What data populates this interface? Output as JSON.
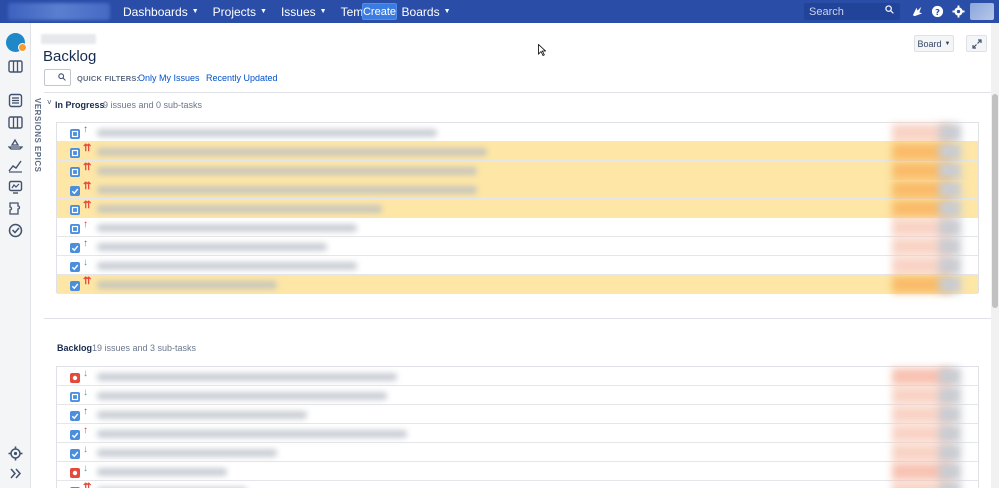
{
  "nav": {
    "items": [
      {
        "label": "Dashboards"
      },
      {
        "label": "Projects"
      },
      {
        "label": "Issues"
      },
      {
        "label": "Tempo"
      },
      {
        "label": "Boards"
      }
    ],
    "create_label": "Create",
    "search_placeholder": "Search",
    "icons": [
      "notifications-icon",
      "help-icon",
      "settings-icon"
    ]
  },
  "header": {
    "title": "Backlog",
    "board_button": "Board",
    "quick_filters_label": "QUICK FILTERS:",
    "quick_filters": [
      "Only My Issues",
      "Recently Updated"
    ]
  },
  "side_tabs": [
    "VERSIONS",
    "EPICS"
  ],
  "in_progress": {
    "title": "In Progress",
    "summary": "9 issues and 0 sub-tasks",
    "rows": [
      {
        "type": "story",
        "priority": "high",
        "highlight": false
      },
      {
        "type": "story",
        "priority": "highest",
        "highlight": true
      },
      {
        "type": "story",
        "priority": "highest",
        "highlight": true
      },
      {
        "type": "task",
        "priority": "highest",
        "highlight": true
      },
      {
        "type": "story",
        "priority": "highest",
        "highlight": true
      },
      {
        "type": "story",
        "priority": "high",
        "highlight": false
      },
      {
        "type": "task",
        "priority": "high",
        "highlight": false
      },
      {
        "type": "task",
        "priority": "low",
        "highlight": false
      },
      {
        "type": "task",
        "priority": "highest",
        "highlight": true
      }
    ]
  },
  "backlog": {
    "title": "Backlog",
    "summary": "19 issues and 3 sub-tasks",
    "rows": [
      {
        "type": "bug",
        "priority": "low"
      },
      {
        "type": "story",
        "priority": "low"
      },
      {
        "type": "task",
        "priority": "high"
      },
      {
        "type": "task",
        "priority": "high"
      },
      {
        "type": "task",
        "priority": "low"
      },
      {
        "type": "bug",
        "priority": "low"
      },
      {
        "type": "task",
        "priority": "highest"
      }
    ]
  },
  "colors": {
    "nav_bg": "#2a4da8",
    "create_bg": "#3b7ce0",
    "highlight_row": "#fde6a6",
    "link": "#0052cc"
  }
}
